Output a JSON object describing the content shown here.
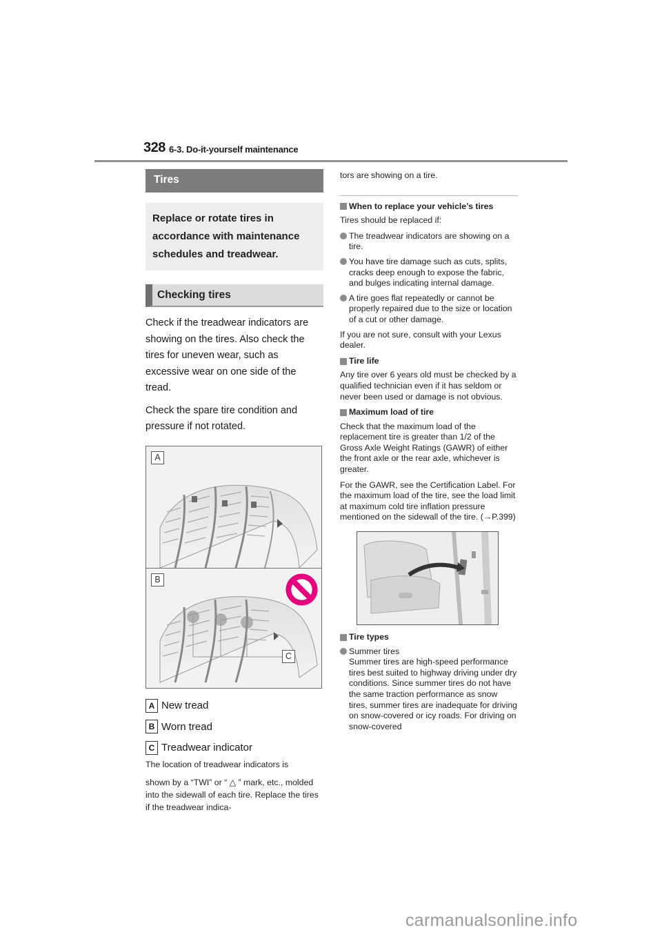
{
  "header": {
    "page_number": "328",
    "section": "6-3. Do-it-yourself maintenance"
  },
  "left": {
    "title_bar": "Tires",
    "intro": "Replace or rotate tires in accordance with maintenance schedules and treadwear.",
    "subheading": "Checking tires",
    "paragraphs": [
      "Check if the treadwear indicators are showing on the tires. Also check the tires for uneven wear, such as excessive wear on one side of the tread.",
      "Check the spare tire condition and pressure if not rotated."
    ],
    "figure": {
      "label_a": "A",
      "label_b": "B",
      "label_c": "C",
      "prohibited_icon_color": "#e6007e"
    },
    "legend": [
      {
        "key": "A",
        "text": "New tread"
      },
      {
        "key": "B",
        "text": "Worn tread"
      },
      {
        "key": "C",
        "text": "Treadwear indicator"
      }
    ],
    "note_line1": "The location of treadwear indicators is",
    "note_line2": "shown by a “TWI” or “ △ ” mark, etc., molded into the sidewall of each tire. Replace the tires if the treadwear indica-"
  },
  "right": {
    "continuation": "tors are showing on a tire.",
    "when_replace": {
      "heading": "When to replace your vehicle’s tires",
      "intro": "Tires should be replaced if:",
      "bullets": [
        "The treadwear indicators are showing on a tire.",
        "You have tire damage such as cuts, splits, cracks deep enough to expose the fabric, and bulges indicating internal damage.",
        "A tire goes flat repeatedly or cannot be properly repaired due to the size or location of a cut or other damage."
      ],
      "outro": "If you are not sure, consult with your Lexus dealer."
    },
    "tire_life": {
      "heading": "Tire life",
      "text": "Any tire over 6 years old must be checked by a qualified technician even if it has seldom or never been used or damage is not obvious."
    },
    "max_load": {
      "heading": "Maximum load of tire",
      "text1": "Check that the maximum load of the replacement tire is greater than 1/2 of the Gross Axle Weight Ratings (GAWR) of either the front axle or the rear axle, whichever is greater.",
      "text2": "For the GAWR, see the Certification Label. For the maximum load of the tire, see the load limit at maximum cold tire inflation pressure mentioned on the sidewall of the tire. (→P.399)"
    },
    "tire_types": {
      "heading": "Tire types",
      "bullet_title": "Summer tires",
      "bullet_text": "Summer tires are high-speed performance tires best suited to highway driving under dry conditions. Since summer tires do not have the same traction performance as snow tires, summer tires are inadequate for driving on snow-covered or icy roads. For driving on snow-covered"
    }
  },
  "watermark": "carmanualsonline.info"
}
